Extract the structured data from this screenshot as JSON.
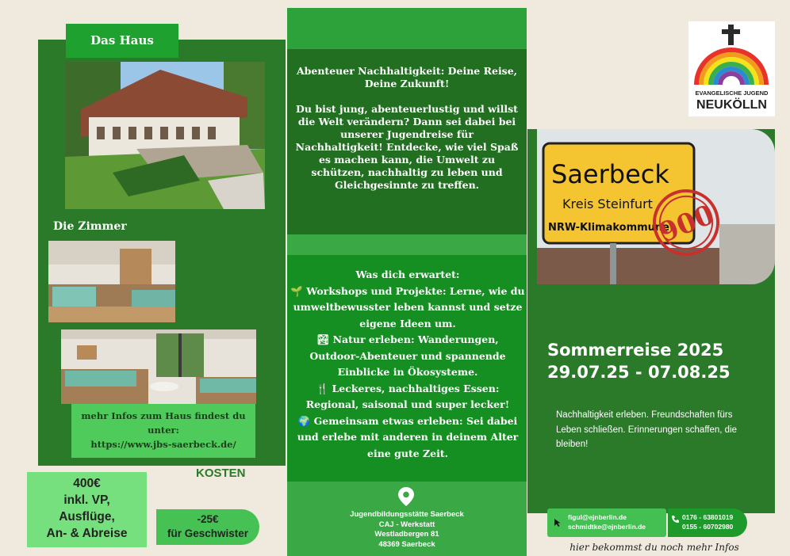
{
  "left": {
    "house_heading": "Das Haus",
    "rooms_heading": "Die Zimmer",
    "more_info_line1": "mehr Infos zum Haus findest du unter:",
    "more_info_link": "https://www.jbs-saerbeck.de/",
    "price": "400€",
    "price_details": [
      "inkl. VP,",
      "Ausflüge,",
      "An- & Abreise"
    ],
    "costs_heading": "KOSTEN",
    "discount_amount": "-25€",
    "discount_label": "für Geschwister"
  },
  "middle": {
    "intro_title": "Abenteuer Nachhaltigkeit: Deine Reise, Deine Zukunft!",
    "intro_body": "Du bist jung, abenteuerlustig und willst die Welt verändern? Dann sei dabei bei unserer Jugendreise für Nachhaltigkeit! Entdecke, wie viel Spaß es machen kann, die Umwelt zu schützen, nachhaltig zu leben und Gleichgesinnte zu treffen.",
    "expect_title": "Was dich erwartet:",
    "expect_items": [
      {
        "icon": "🌱",
        "text": "Workshops und Projekte: Lerne, wie du umweltbewusster leben kannst und setze eigene Ideen um."
      },
      {
        "icon": "🏞",
        "text": "Natur erleben: Wanderungen, Outdoor-Abenteuer und spannende Einblicke in Ökosysteme."
      },
      {
        "icon": "🍴",
        "text": "Leckeres, nachhaltiges Essen: Regional, saisonal und super lecker!"
      },
      {
        "icon": "🌍",
        "text": "Gemeinsam etwas erleben: Sei dabei und erlebe mit anderen in deinem Alter eine gute Zeit."
      }
    ],
    "address": [
      "Jugendbildungsstätte Saerbeck",
      "CAJ - Werkstatt",
      "Westladbergen 81",
      "48369 Saerbeck"
    ]
  },
  "right": {
    "logo_line1": "EVANGELISCHE JUGEND",
    "logo_line2": "NEUKÖLLN",
    "sign_town": "Saerbeck",
    "sign_district": "Kreis Steinfurt",
    "sign_subtitle": "NRW-Klimakommune",
    "stamp_number": "900",
    "trip_title": "Sommerreise 2025",
    "trip_dates": "29.07.25 - 07.08.25",
    "tagline": "Nachhaltigkeit erleben. Freundschaften fürs Leben schließen. Erinnerungen schaffen, die bleiben!",
    "emails": [
      "figul@ejnberlin.de",
      "schmidtke@ejnberlin.de"
    ],
    "phones": [
      "0176 - 63801019",
      "0155 - 60702980"
    ],
    "more_infos": "hier bekommst du noch mehr Infos"
  },
  "colors": {
    "background": "#efe9de",
    "dark_green": "#2a7a2a",
    "bright_green": "#1fa12f",
    "light_green": "#76e07e",
    "sign_yellow": "#f4c531"
  }
}
